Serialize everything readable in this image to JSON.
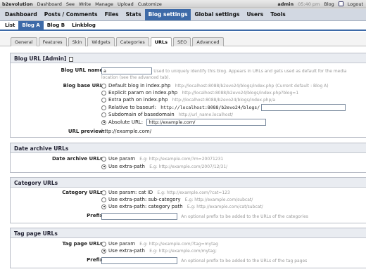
{
  "topbar": {
    "brand": "b2evolution",
    "menu": [
      "Dashboard",
      "See",
      "Write",
      "Manage",
      "Upload",
      "Customize"
    ],
    "user": "admin",
    "time": "05:40 pm",
    "blog_link": "Blog",
    "logout": "Logout"
  },
  "mainnav": [
    "Dashboard",
    "Posts / Comments",
    "Files",
    "Stats",
    "Blog settings",
    "Global settings",
    "Users",
    "Tools"
  ],
  "blognav": [
    "List",
    "Blog A",
    "Blog B",
    "Linkblog"
  ],
  "subtabs": [
    "General",
    "Features",
    "Skin",
    "Widgets",
    "Categories",
    "URLs",
    "SEO",
    "Advanced"
  ],
  "blog_url": {
    "title": "Blog URL [Admin]",
    "name_label": "Blog URL name:",
    "name_value": "a",
    "name_hint": "Used to uniquely identify this blog. Appears in URLs and gets used as default for the media",
    "name_hint2": "location (see the advanced tab).",
    "base_label": "Blog base URL:",
    "options": [
      {
        "label": "Default blog in index.php",
        "hint": "http://localhost:8088/b2evo24/blogs/index.php (Current default : Blog A)"
      },
      {
        "label": "Explicit param on index.php",
        "hint": "http://localhost:8088/b2evo24/blogs/index.php?blog=1"
      },
      {
        "label": "Extra path on index.php",
        "hint": "http://localhost:8088/b2evo24/blogs/index.php/a"
      },
      {
        "label": "Relative to baseurl:",
        "hint": "http://localhost:8088/b2evo24/blogs/"
      },
      {
        "label": "Subdomain of basedomain",
        "hint": "http://url_name.localhost/"
      },
      {
        "label": "Absolute URL:",
        "value": "http://example.com/"
      }
    ],
    "preview_label": "URL preview:",
    "preview_value": "http://example.com/"
  },
  "date_archive": {
    "title": "Date archive URLs",
    "label": "Date archive URLs:",
    "opt1": "Use param",
    "opt1_eg": "E.g: http://example.com/?m=20071231",
    "opt2": "Use extra-path",
    "opt2_eg": "E.g: http://example.com/2007/12/31/"
  },
  "category": {
    "title": "Category URLs",
    "label": "Category URLs:",
    "opt1": "Use param: cat ID",
    "opt1_eg": "E.g: http://example.com/?cat=123",
    "opt2": "Use extra-path: sub-category",
    "opt2_eg": "E.g: http://example.com/subcat/",
    "opt3": "Use extra-path: category path",
    "opt3_eg": "E.g: http://example.com/cat/subcat/",
    "prefix_label": "Prefix:",
    "prefix_hint": "An optional prefix to be added to the URLs of the categories"
  },
  "tags": {
    "title": "Tag page URLs",
    "label": "Tag page URLs:",
    "opt1": "Use param",
    "opt1_eg": "E.g: http://example.com/?tag=mytag",
    "opt2": "Use extra-path",
    "opt2_eg": "E.g: http://example.com/mytag;",
    "prefix_label": "Prefix:",
    "prefix_hint": "An optional prefix to be added to the URLs of the tag pages"
  }
}
